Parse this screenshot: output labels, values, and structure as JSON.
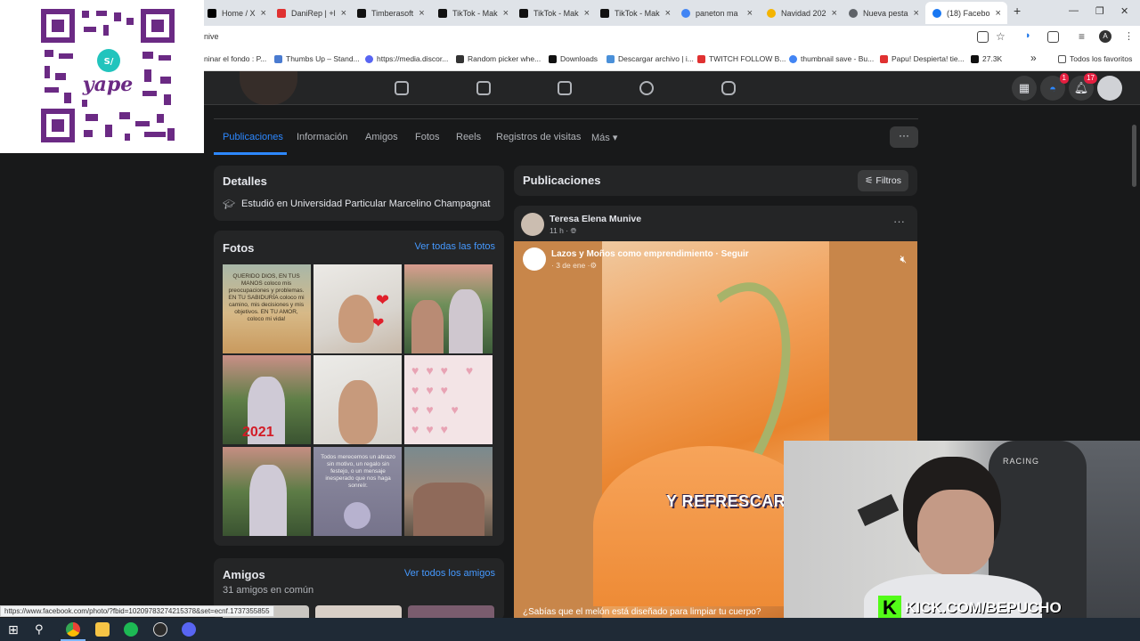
{
  "browser": {
    "tabs": [
      {
        "label": "Home / X",
        "icon_color": "#000000"
      },
      {
        "label": "DaniRep | +l",
        "icon_color": "#e03131"
      },
      {
        "label": "Timberasoft",
        "icon_color": "#111111"
      },
      {
        "label": "TikTok - Mak",
        "icon_color": "#111111"
      },
      {
        "label": "TikTok - Mak",
        "icon_color": "#111111"
      },
      {
        "label": "TikTok - Mak",
        "icon_color": "#111111"
      },
      {
        "label": "paneton ma",
        "icon_color": "#4285f4"
      },
      {
        "label": "Navidad 202",
        "icon_color": "#f4b400"
      },
      {
        "label": "Nueva pesta",
        "icon_color": "#5f6368"
      },
      {
        "label": "(18) Facebo",
        "icon_color": "#1877f2"
      }
    ],
    "new_tab": "+",
    "url_fragment": "nive",
    "bookmarks": [
      {
        "label": "ninar el fondo : P...",
        "icon_color": "#888888"
      },
      {
        "label": "Thumbs Up – Stand...",
        "icon_color": "#4a7bd0"
      },
      {
        "label": "https://media.discor...",
        "icon_color": "#5865f2"
      },
      {
        "label": "Random picker whe...",
        "icon_color": "#333333"
      },
      {
        "label": "Downloads",
        "icon_color": "#111111"
      },
      {
        "label": "Descargar archivo | i...",
        "icon_color": "#4a90d9"
      },
      {
        "label": "TWITCH FOLLOW B...",
        "icon_color": "#e03131"
      },
      {
        "label": "thumbnail save - Bu...",
        "icon_color": "#4285f4"
      },
      {
        "label": "Papu! Despierta! tie...",
        "icon_color": "#e03131"
      },
      {
        "label": "27.3K",
        "icon_color": "#111111"
      }
    ],
    "bookmarks_more": "»",
    "favorites_label": "Todos los favoritos",
    "profile_initial": "A"
  },
  "fb_nav": {
    "messenger_badge": "1",
    "notifications_badge": "17"
  },
  "profile_tabs": {
    "items": [
      "Publicaciones",
      "Información",
      "Amigos",
      "Fotos",
      "Reels",
      "Registros de visitas",
      "Más ▾"
    ],
    "more_button": "···"
  },
  "details": {
    "title": "Detalles",
    "education": "Estudió en Universidad Particular Marcelino Champagnat"
  },
  "photos": {
    "title": "Fotos",
    "see_all": "Ver todas las fotos",
    "quote_1": "QUERIDO DIOS, EN TUS MANOS coloco mis preocupaciones y problemas. EN TU SABIDURÍA coloco mi camino, mis decisiones y mis objetivos. EN TU AMOR, coloco mi vida!",
    "year_text": "2021",
    "quote_2": "Todos merecemos un abrazo sin motivo, un regalo sin festejo, o un mensaje inesperado que nos haga sonreír."
  },
  "friends": {
    "title": "Amigos",
    "count": "31 amigos en común",
    "see_all": "Ver todos los amigos"
  },
  "posts": {
    "title": "Publicaciones",
    "filters": "Filtros",
    "author": "Teresa Elena Munive",
    "time": "11 h ·",
    "shared_page": "Lazos y Moños como emprendimiento · Seguir",
    "shared_date": "· 3 de ene ·",
    "video_caption": "Y REFRESCAR",
    "text": "¿Sabías que el melón está diseñado para limpiar tu cuerpo?"
  },
  "status_url": "https://www.facebook.com/photo/?fbid=10209783274215378&set=ecnf.1737355855",
  "webcam": {
    "overlay_text": "KICK.COM/BEPUCHO",
    "chair_text": "RACING"
  },
  "colors": {
    "fb_blue": "#2d88ff",
    "kick_green": "#53fc18",
    "card_bg": "#242526"
  }
}
